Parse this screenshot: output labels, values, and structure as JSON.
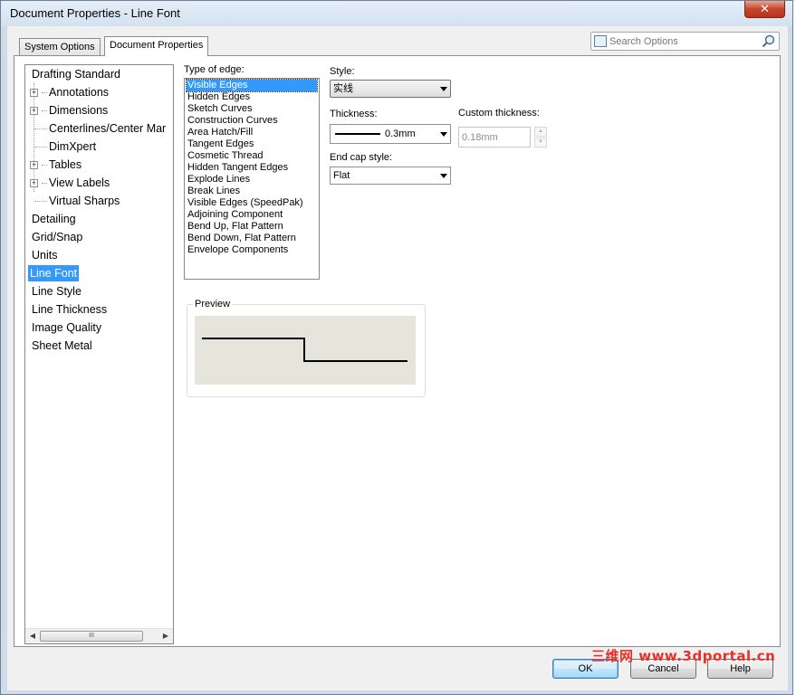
{
  "window": {
    "title": "Document Properties - Line Font",
    "close_glyph": "✕"
  },
  "tabs": [
    {
      "label": "System Options",
      "active": false
    },
    {
      "label": "Document Properties",
      "active": true
    }
  ],
  "search": {
    "placeholder": "Search Options",
    "icon": "search-icon"
  },
  "tree": {
    "items": [
      {
        "label": "Drafting Standard",
        "level": 0,
        "expandable": false,
        "selected": false
      },
      {
        "label": "Annotations",
        "level": 1,
        "expandable": true,
        "selected": false
      },
      {
        "label": "Dimensions",
        "level": 1,
        "expandable": true,
        "selected": false
      },
      {
        "label": "Centerlines/Center Mar",
        "level": 1,
        "expandable": false,
        "selected": false
      },
      {
        "label": "DimXpert",
        "level": 1,
        "expandable": false,
        "selected": false
      },
      {
        "label": "Tables",
        "level": 1,
        "expandable": true,
        "selected": false
      },
      {
        "label": "View Labels",
        "level": 1,
        "expandable": true,
        "selected": false
      },
      {
        "label": "Virtual Sharps",
        "level": 1,
        "expandable": false,
        "selected": false
      },
      {
        "label": "Detailing",
        "level": 0,
        "expandable": false,
        "selected": false
      },
      {
        "label": "Grid/Snap",
        "level": 0,
        "expandable": false,
        "selected": false
      },
      {
        "label": "Units",
        "level": 0,
        "expandable": false,
        "selected": false
      },
      {
        "label": "Line Font",
        "level": 0,
        "expandable": false,
        "selected": true
      },
      {
        "label": "Line Style",
        "level": 0,
        "expandable": false,
        "selected": false
      },
      {
        "label": "Line Thickness",
        "level": 0,
        "expandable": false,
        "selected": false
      },
      {
        "label": "Image Quality",
        "level": 0,
        "expandable": false,
        "selected": false
      },
      {
        "label": "Sheet Metal",
        "level": 0,
        "expandable": false,
        "selected": false
      }
    ],
    "scroll_grip": "III"
  },
  "edge_types": {
    "label": "Type of edge:",
    "items": [
      "Visible Edges",
      "Hidden Edges",
      "Sketch Curves",
      "Construction Curves",
      "Area Hatch/Fill",
      "Tangent Edges",
      "Cosmetic Thread",
      "Hidden Tangent Edges",
      "Explode Lines",
      "Break Lines",
      "Visible Edges (SpeedPak)",
      "Adjoining Component",
      "Bend Up, Flat Pattern",
      "Bend Down, Flat Pattern",
      "Envelope Components"
    ],
    "selected": "Visible Edges"
  },
  "style": {
    "label": "Style:",
    "value": "实线"
  },
  "thickness": {
    "label": "Thickness:",
    "value": "0.3mm"
  },
  "custom_thickness": {
    "label": "Custom thickness:",
    "value": "0.18mm"
  },
  "end_cap": {
    "label": "End cap style:",
    "value": "Flat"
  },
  "preview": {
    "label": "Preview"
  },
  "buttons": {
    "ok": "OK",
    "cancel": "Cancel",
    "help": "Help"
  },
  "watermark": "三维网 www.3dportal.cn",
  "colors": {
    "selection": "#3399ff",
    "preview_bg": "#e6e5dc",
    "watermark": "#e8302a"
  }
}
